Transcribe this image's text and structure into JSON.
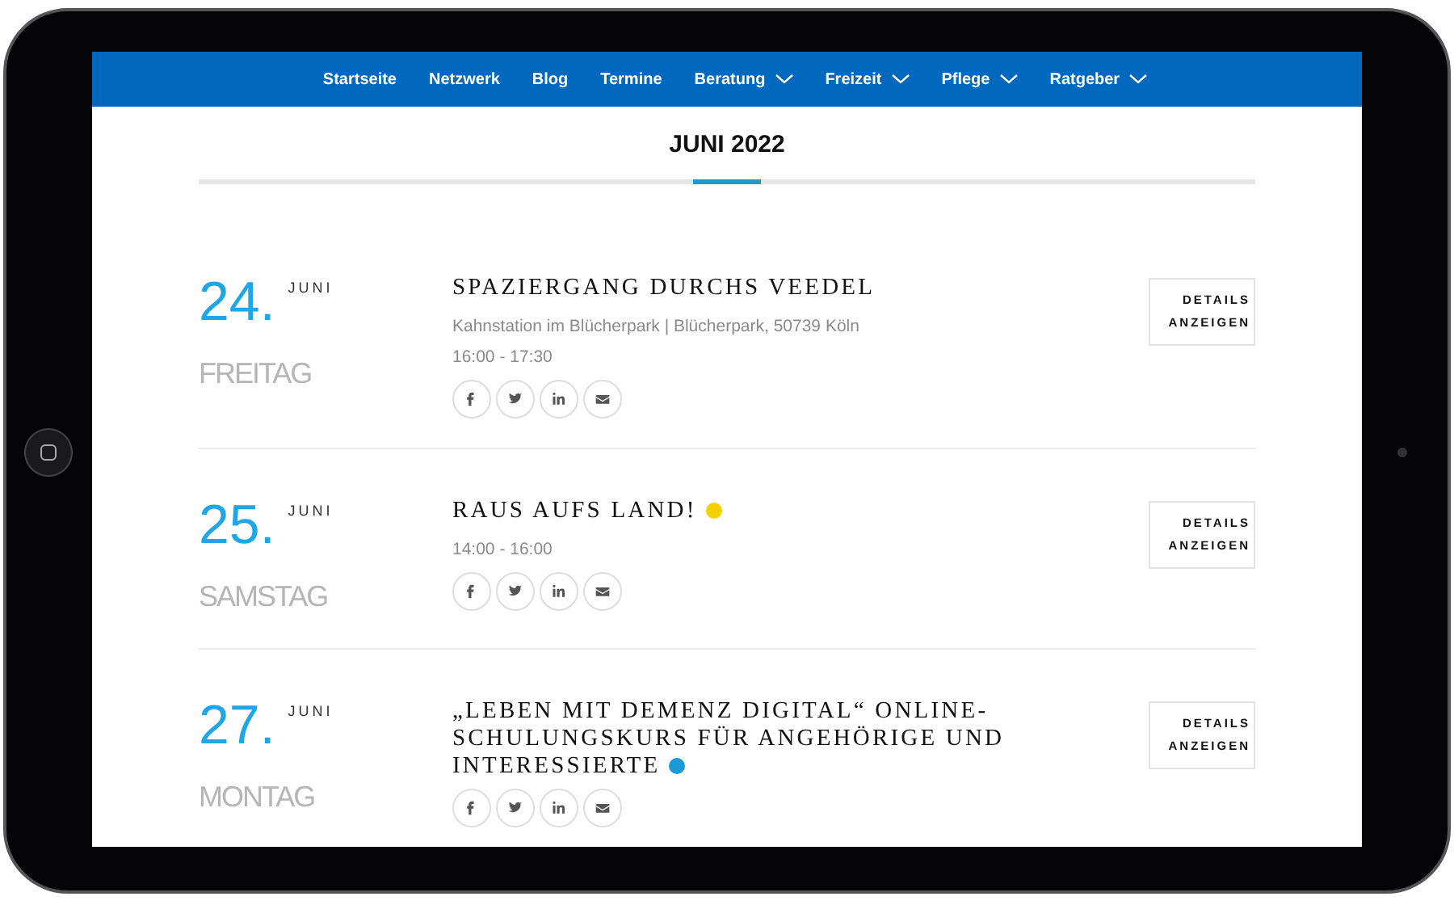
{
  "nav": [
    {
      "label": "Startseite",
      "dropdown": false
    },
    {
      "label": "Netzwerk",
      "dropdown": false
    },
    {
      "label": "Blog",
      "dropdown": false
    },
    {
      "label": "Termine",
      "dropdown": false
    },
    {
      "label": "Beratung",
      "dropdown": true
    },
    {
      "label": "Freizeit",
      "dropdown": true
    },
    {
      "label": "Pflege",
      "dropdown": true
    },
    {
      "label": "Ratgeber",
      "dropdown": true
    }
  ],
  "heading": "JUNI 2022",
  "events": [
    {
      "day": "24.",
      "month": "JUNI",
      "weekday": "FREITAG",
      "title": "SPAZIERGANG DURCHS VEEDEL",
      "location": "Kahnstation im Blücherpark | Blücherpark, 50739 Köln",
      "time": "16:00 - 17:30",
      "button": [
        "DETAILS",
        "ANZEIGEN"
      ]
    },
    {
      "day": "25.",
      "month": "JUNI",
      "weekday": "SAMSTAG",
      "title": "RAUS AUFS LAND!",
      "color": "#f5d000",
      "time": "14:00 - 16:00",
      "button": [
        "DETAILS",
        "ANZEIGEN"
      ]
    },
    {
      "day": "27.",
      "month": "JUNI",
      "weekday": "MONTAG",
      "title": "„LEBEN MIT DEMENZ DIGITAL“ ONLINE-SCHULUNGSKURS FÜR ANGEHÖRIGE UND INTERESSIERTE",
      "color": "#1a9bd7",
      "button": [
        "DETAILS",
        "ANZEIGEN"
      ]
    }
  ]
}
